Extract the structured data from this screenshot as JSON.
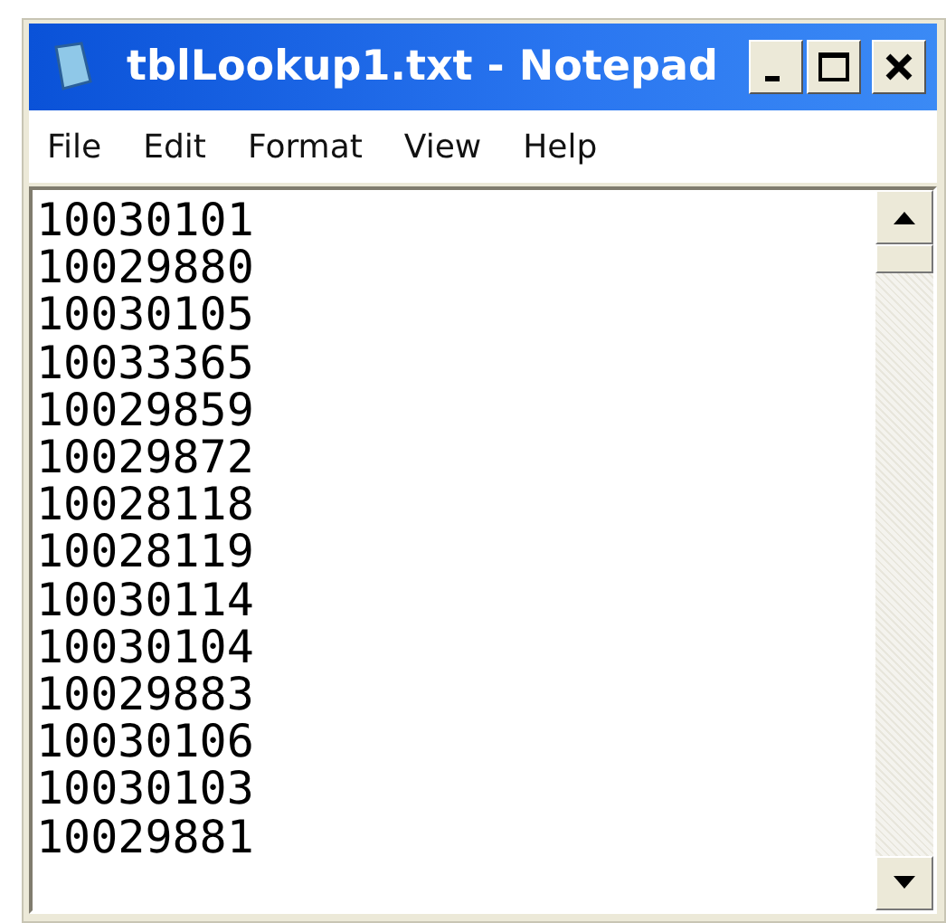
{
  "window": {
    "title": "tblLookup1.txt - Notepad"
  },
  "menu": [
    "File",
    "Edit",
    "Format",
    "View",
    "Help"
  ],
  "editor": {
    "lines": [
      "10030101",
      "10029880",
      "10030105",
      "10033365",
      "10029859",
      "10029872",
      "10028118",
      "10028119",
      "10030114",
      "10030104",
      "10029883",
      "10030106",
      "10030103",
      "10029881"
    ]
  }
}
